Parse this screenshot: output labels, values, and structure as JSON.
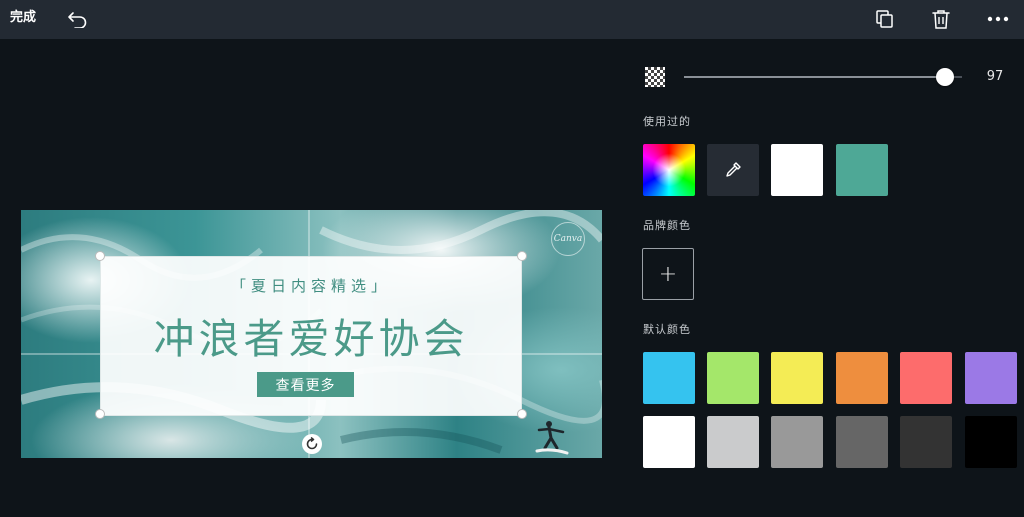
{
  "topbar": {
    "done_label": "完成",
    "icons": [
      "undo-icon",
      "duplicate-icon",
      "trash-icon",
      "more-icon"
    ]
  },
  "design": {
    "subtitle": "「夏日内容精选」",
    "title": "冲浪者爱好协会",
    "button_label": "查看更多",
    "watermark": "Canva"
  },
  "panel": {
    "transparency": {
      "value": 97,
      "value_text": "97",
      "fraction": 0.97
    },
    "used_label": "使用过的",
    "used_colors": [
      "rainbow",
      "eyedropper",
      "#ffffff",
      "#4ea896"
    ],
    "brand_label": "品牌颜色",
    "brand_add_label": "+",
    "default_label": "默认颜色",
    "default_colors_row1": [
      "#35c3ef",
      "#a4e76a",
      "#f4ec55",
      "#ee8e3e",
      "#fd6c6c",
      "#9b79e6"
    ],
    "default_colors_row2": [
      "#ffffff",
      "#cacbcc",
      "#999999",
      "#666666",
      "#333333",
      "#000000"
    ]
  }
}
